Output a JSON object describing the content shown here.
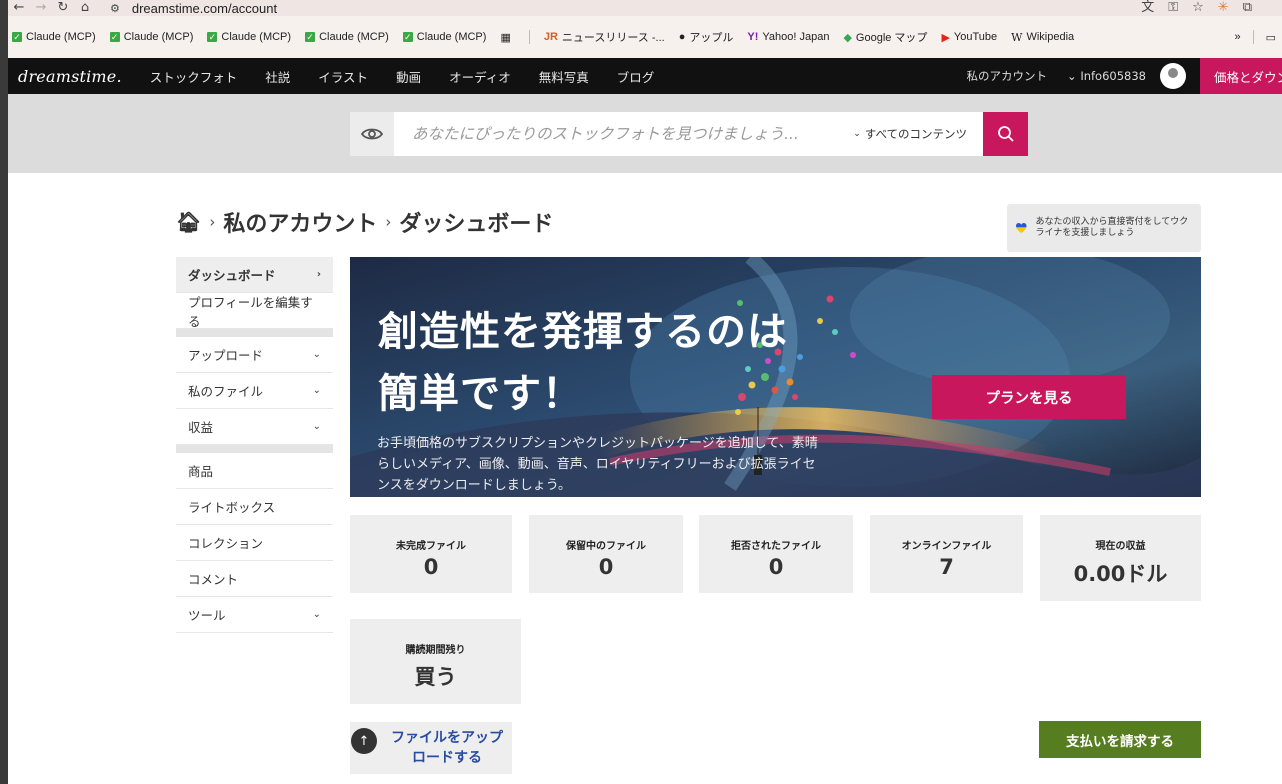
{
  "browser": {
    "url": "dreamstime.com/account",
    "bookmarks": [
      {
        "label": "Claude (MCP)"
      },
      {
        "label": "Claude (MCP)"
      },
      {
        "label": "Claude (MCP)"
      },
      {
        "label": "Claude (MCP)"
      },
      {
        "label": "Claude (MCP)"
      }
    ],
    "bookmarks_more": [
      {
        "label": "ニュースリリース -..."
      },
      {
        "label": "アップル"
      },
      {
        "label": "Yahoo! Japan"
      },
      {
        "label": "Google マップ"
      },
      {
        "label": "YouTube"
      },
      {
        "label": "Wikipedia"
      }
    ],
    "overflow": "»"
  },
  "nav": {
    "logo": "dreamstime.",
    "links": [
      "ストックフォト",
      "社説",
      "イラスト",
      "動画",
      "オーディオ",
      "無料写真",
      "ブログ"
    ],
    "account": "私のアカウント",
    "user": "Info605838",
    "pricing": "価格とダウン"
  },
  "search": {
    "placeholder": "あなたにぴったりのストックフォトを見つけましょう...",
    "scope": "すべてのコンテンツ"
  },
  "breadcrumb": {
    "items": [
      "私のアカウント",
      "ダッシュボード"
    ]
  },
  "ukraine": {
    "text": "あなたの収入から直接寄付をしてウクライナを支援しましょう"
  },
  "sidebar": {
    "items": [
      {
        "label": "ダッシュボード"
      },
      {
        "label": "プロフィールを編集する"
      },
      {
        "label": "アップロード"
      },
      {
        "label": "私のファイル"
      },
      {
        "label": "収益"
      },
      {
        "label": "商品"
      },
      {
        "label": "ライトボックス"
      },
      {
        "label": "コレクション"
      },
      {
        "label": "コメント"
      },
      {
        "label": "ツール"
      }
    ]
  },
  "hero": {
    "title_line1": "創造性を発揮するのは",
    "title_line2": "簡単です！",
    "text": "お手頃価格のサブスクリプションやクレジットパッケージを追加して、素晴らしいメディア、画像、動画、音声、ロイヤリティフリーおよび拡張ライセンスをダウンロードしましょう。",
    "cta": "プランを見る"
  },
  "stats": [
    {
      "label": "未完成ファイル",
      "value": "0"
    },
    {
      "label": "保留中のファイル",
      "value": "0"
    },
    {
      "label": "拒否されたファイル",
      "value": "0"
    },
    {
      "label": "オンラインファイル",
      "value": "7"
    },
    {
      "label": "現在の収益",
      "value": "0.00ドル"
    },
    {
      "label": "購読期間残り",
      "value": "買う"
    }
  ],
  "actions": {
    "upload": "ファイルをアップロードする",
    "payout": "支払いを請求する"
  },
  "colors": {
    "brand": "#c8175d",
    "nav_bg": "#111111",
    "payout": "#567d1f",
    "link": "#2a4ca0"
  }
}
